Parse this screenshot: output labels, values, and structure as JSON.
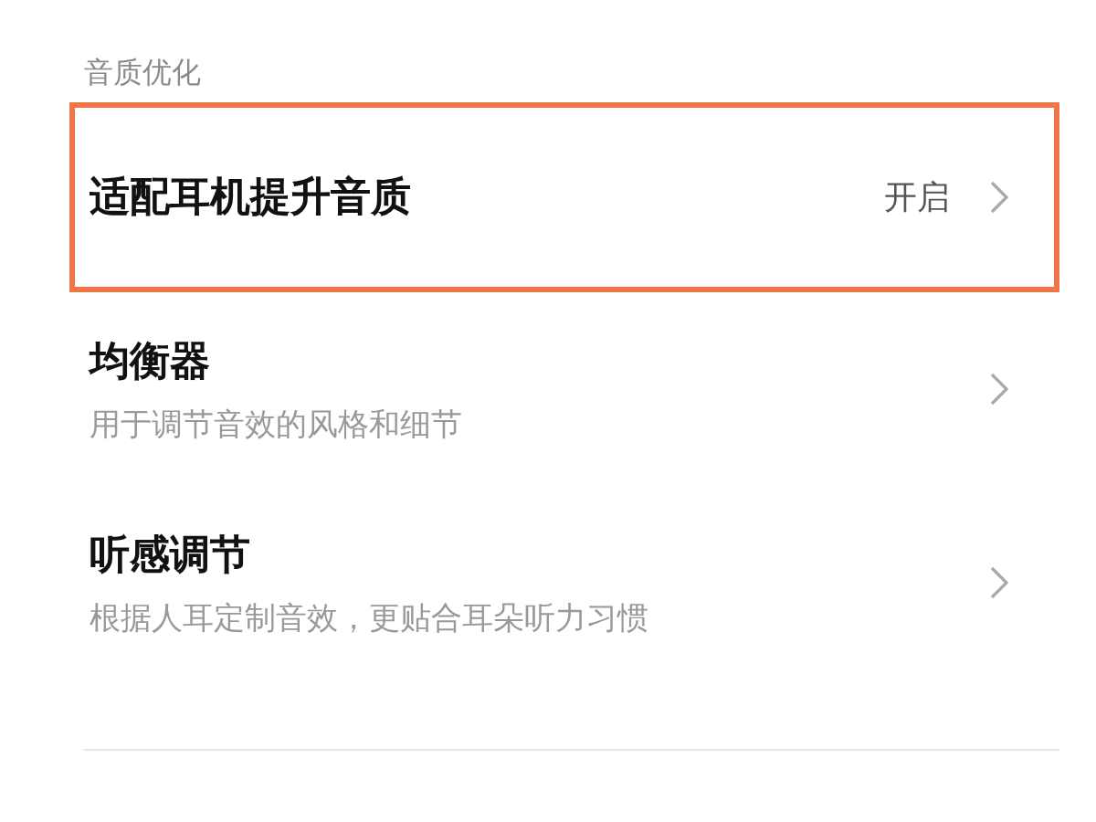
{
  "section": {
    "title": "音质优化"
  },
  "items": [
    {
      "title": "适配耳机提升音质",
      "value": "开启",
      "highlighted": true
    },
    {
      "title": "均衡器",
      "subtitle": "用于调节音效的风格和细节",
      "highlighted": false
    },
    {
      "title": "听感调节",
      "subtitle": "根据人耳定制音效，更贴合耳朵听力习惯",
      "highlighted": false
    }
  ]
}
